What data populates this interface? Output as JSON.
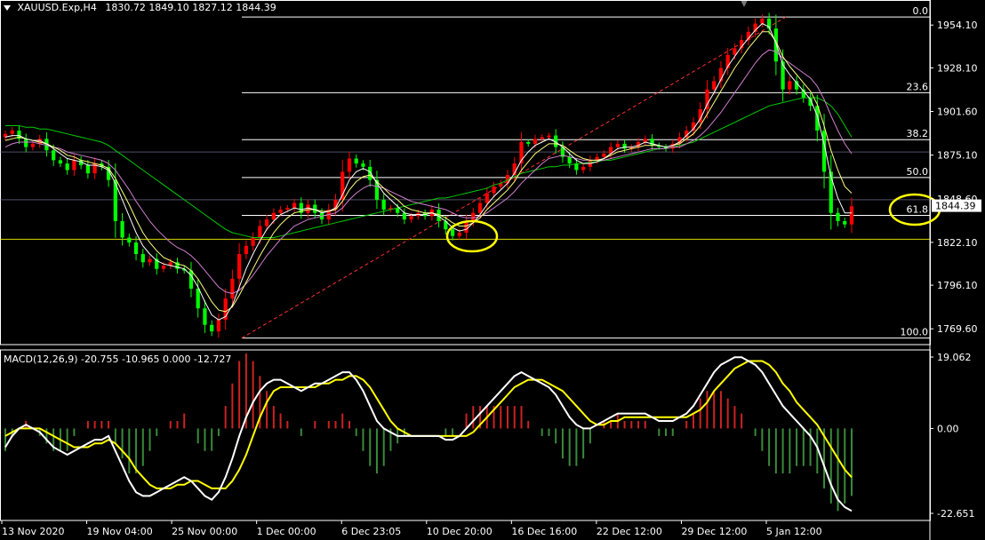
{
  "header": {
    "symbol": "XAUUSD.Exp,H4",
    "ohlc": "1830.72 1849.10 1827.12 1844.39"
  },
  "current_price_label": "1844.39",
  "macd": {
    "title": "MACD(12,26,9) -20.755 -10.965 0.000 -12.727",
    "scale_labels": [
      "19.062",
      "0.00",
      "-22.651"
    ]
  },
  "colors": {
    "background": "#000000",
    "bull": "#ff0000",
    "bear": "#00ff00",
    "ma_fast": "#ffffff",
    "ma_mid": "#ffff80",
    "ma_slow": "#d080d0",
    "ma_long": "#00cc00",
    "fib": "#ffffff",
    "trend": "#ff3030",
    "highlight": "#ffff00",
    "macd_main": "#ffffff",
    "macd_signal": "#ffff00",
    "hist_pos": "#cc2222",
    "hist_neg": "#3a8a3a"
  },
  "chart_data": [
    {
      "type": "candlestick",
      "title": "XAUUSD.Exp,H4",
      "price_axis_labels": [
        "1954.10",
        "1928.10",
        "1901.60",
        "1875.10",
        "1848.60",
        "1822.10",
        "1796.10",
        "1769.60"
      ],
      "ylim": [
        1760,
        1965
      ],
      "time_axis_labels": [
        "13 Nov 2020",
        "19 Nov 04:00",
        "25 Nov 00:00",
        "1 Dec 00:00",
        "6 Dec 23:05",
        "10 Dec 20:00",
        "16 Dec 16:00",
        "22 Dec 12:00",
        "29 Dec 12:00",
        "5 Jan 12:00"
      ],
      "last_price": 1844.39,
      "fibonacci": {
        "high": 1959,
        "low": 1764,
        "levels": [
          {
            "label": "0.0",
            "ratio": 0.0
          },
          {
            "label": "23.6",
            "ratio": 0.236
          },
          {
            "label": "38.2",
            "ratio": 0.382
          },
          {
            "label": "50.0",
            "ratio": 0.5
          },
          {
            "label": "61.8",
            "ratio": 0.618
          },
          {
            "label": "100.0",
            "ratio": 1.0
          }
        ]
      },
      "horizontal_lines": [
        1824,
        1848,
        1877
      ],
      "price_path": [
        1888,
        1890,
        1885,
        1880,
        1882,
        1885,
        1878,
        1872,
        1870,
        1866,
        1872,
        1869,
        1864,
        1870,
        1868,
        1860,
        1835,
        1825,
        1822,
        1815,
        1810,
        1812,
        1806,
        1808,
        1810,
        1806,
        1805,
        1794,
        1782,
        1772,
        1768,
        1775,
        1788,
        1800,
        1815,
        1820,
        1825,
        1832,
        1836,
        1840,
        1842,
        1843,
        1846,
        1840,
        1845,
        1840,
        1836,
        1842,
        1848,
        1865,
        1873,
        1870,
        1868,
        1860,
        1848,
        1842,
        1843,
        1840,
        1836,
        1838,
        1840,
        1838,
        1842,
        1835,
        1830,
        1826,
        1828,
        1835,
        1840,
        1846,
        1852,
        1856,
        1858,
        1863,
        1870,
        1883,
        1882,
        1885,
        1886,
        1887,
        1880,
        1874,
        1870,
        1866,
        1868,
        1872,
        1874,
        1876,
        1880,
        1882,
        1879,
        1880,
        1883,
        1885,
        1881,
        1880,
        1879,
        1882,
        1886,
        1890,
        1895,
        1903,
        1915,
        1920,
        1928,
        1936,
        1940,
        1945,
        1950,
        1955,
        1958,
        1952,
        1932,
        1915,
        1920,
        1915,
        1910,
        1905,
        1890,
        1865,
        1840,
        1835,
        1833,
        1844
      ],
      "ma_fast": [
        1886,
        1887,
        1887,
        1885,
        1884,
        1884,
        1882,
        1879,
        1876,
        1873,
        1872,
        1871,
        1869,
        1869,
        1868,
        1866,
        1858,
        1848,
        1838,
        1828,
        1820,
        1815,
        1811,
        1809,
        1808,
        1807,
        1806,
        1802,
        1795,
        1786,
        1778,
        1775,
        1777,
        1784,
        1795,
        1806,
        1815,
        1823,
        1830,
        1835,
        1839,
        1841,
        1843,
        1842,
        1843,
        1842,
        1840,
        1841,
        1843,
        1851,
        1860,
        1865,
        1867,
        1865,
        1858,
        1852,
        1848,
        1844,
        1840,
        1839,
        1839,
        1839,
        1840,
        1838,
        1835,
        1831,
        1829,
        1830,
        1834,
        1839,
        1845,
        1850,
        1854,
        1858,
        1864,
        1872,
        1877,
        1881,
        1883,
        1885,
        1883,
        1880,
        1876,
        1872,
        1870,
        1870,
        1871,
        1873,
        1876,
        1879,
        1880,
        1880,
        1881,
        1883,
        1882,
        1881,
        1880,
        1881,
        1883,
        1887,
        1891,
        1897,
        1906,
        1913,
        1921,
        1929,
        1935,
        1941,
        1946,
        1951,
        1955,
        1953,
        1943,
        1930,
        1924,
        1919,
        1914,
        1909,
        1899,
        1882,
        1862,
        1849,
        1840,
        1840
      ],
      "ma_mid": [
        1884,
        1885,
        1886,
        1885,
        1884,
        1883,
        1882,
        1880,
        1878,
        1875,
        1874,
        1872,
        1871,
        1870,
        1869,
        1867,
        1861,
        1853,
        1845,
        1836,
        1828,
        1822,
        1817,
        1813,
        1811,
        1809,
        1808,
        1805,
        1800,
        1793,
        1786,
        1781,
        1780,
        1783,
        1790,
        1798,
        1806,
        1814,
        1821,
        1828,
        1833,
        1837,
        1840,
        1841,
        1842,
        1842,
        1841,
        1841,
        1842,
        1847,
        1854,
        1859,
        1862,
        1863,
        1859,
        1855,
        1851,
        1848,
        1844,
        1842,
        1841,
        1840,
        1840,
        1839,
        1837,
        1834,
        1832,
        1832,
        1834,
        1837,
        1842,
        1846,
        1850,
        1854,
        1859,
        1866,
        1871,
        1876,
        1879,
        1882,
        1882,
        1881,
        1878,
        1875,
        1873,
        1872,
        1872,
        1873,
        1875,
        1877,
        1878,
        1879,
        1880,
        1881,
        1881,
        1881,
        1880,
        1881,
        1882,
        1885,
        1888,
        1893,
        1900,
        1907,
        1914,
        1921,
        1928,
        1934,
        1940,
        1945,
        1950,
        1950,
        1944,
        1935,
        1929,
        1924,
        1919,
        1914,
        1906,
        1893,
        1878,
        1866,
        1856,
        1852
      ],
      "ma_slow": [
        1880,
        1882,
        1883,
        1883,
        1883,
        1882,
        1881,
        1880,
        1879,
        1877,
        1876,
        1875,
        1874,
        1873,
        1872,
        1870,
        1866,
        1860,
        1854,
        1847,
        1841,
        1835,
        1830,
        1826,
        1822,
        1819,
        1817,
        1814,
        1810,
        1805,
        1800,
        1795,
        1792,
        1791,
        1793,
        1797,
        1802,
        1808,
        1814,
        1819,
        1824,
        1828,
        1832,
        1834,
        1836,
        1837,
        1838,
        1839,
        1840,
        1843,
        1848,
        1852,
        1855,
        1857,
        1856,
        1855,
        1853,
        1851,
        1849,
        1847,
        1846,
        1845,
        1844,
        1843,
        1842,
        1840,
        1838,
        1837,
        1837,
        1838,
        1840,
        1843,
        1846,
        1849,
        1853,
        1858,
        1862,
        1866,
        1870,
        1873,
        1874,
        1875,
        1874,
        1873,
        1872,
        1872,
        1872,
        1872,
        1873,
        1874,
        1875,
        1876,
        1877,
        1878,
        1879,
        1879,
        1879,
        1880,
        1880,
        1882,
        1884,
        1887,
        1891,
        1896,
        1901,
        1907,
        1913,
        1919,
        1925,
        1931,
        1936,
        1939,
        1938,
        1934,
        1931,
        1928,
        1925,
        1922,
        1917,
        1909,
        1899,
        1890,
        1882,
        1876
      ],
      "ma_long": [
        1893,
        1893,
        1893,
        1892,
        1892,
        1891,
        1891,
        1890,
        1889,
        1888,
        1887,
        1886,
        1885,
        1884,
        1883,
        1881,
        1878,
        1875,
        1872,
        1869,
        1866,
        1863,
        1860,
        1857,
        1854,
        1851,
        1848,
        1845,
        1842,
        1839,
        1836,
        1833,
        1830,
        1828,
        1827,
        1826,
        1825,
        1825,
        1825,
        1825,
        1826,
        1827,
        1828,
        1829,
        1830,
        1831,
        1832,
        1833,
        1834,
        1835,
        1836,
        1837,
        1838,
        1839,
        1840,
        1841,
        1842,
        1843,
        1844,
        1845,
        1846,
        1847,
        1848,
        1849,
        1849,
        1850,
        1851,
        1852,
        1853,
        1854,
        1855,
        1857,
        1858,
        1860,
        1862,
        1864,
        1865,
        1866,
        1867,
        1868,
        1868,
        1869,
        1869,
        1870,
        1870,
        1871,
        1871,
        1872,
        1872,
        1873,
        1874,
        1875,
        1876,
        1877,
        1878,
        1879,
        1879,
        1880,
        1881,
        1882,
        1883,
        1885,
        1887,
        1889,
        1891,
        1893,
        1895,
        1897,
        1899,
        1901,
        1903,
        1905,
        1906,
        1907,
        1908,
        1909,
        1910,
        1910,
        1910,
        1908,
        1905,
        1900,
        1893,
        1886
      ]
    },
    {
      "type": "macd",
      "title": "MACD(12,26,9) -20.755 -10.965 0.000 -12.727",
      "ylim": [
        -22.651,
        19.062
      ],
      "main": [
        -5,
        -2,
        0,
        1,
        0,
        -1,
        -3,
        -5,
        -6,
        -7,
        -6,
        -5,
        -4,
        -3,
        -3,
        -2,
        -6,
        -10,
        -14,
        -17,
        -18,
        -18,
        -17,
        -16,
        -15,
        -14,
        -13,
        -14,
        -16,
        -18,
        -19,
        -17,
        -13,
        -8,
        -2,
        3,
        7,
        10,
        12,
        13,
        13,
        12,
        11,
        10,
        11,
        12,
        12,
        13,
        14,
        15,
        15,
        13,
        10,
        6,
        2,
        0,
        -1,
        -2,
        -2,
        -2,
        -2,
        -2,
        -2,
        -2,
        -3,
        -3,
        -2,
        0,
        2,
        4,
        6,
        8,
        10,
        12,
        14,
        15,
        14,
        13,
        12,
        11,
        9,
        6,
        3,
        1,
        0,
        0,
        1,
        2,
        3,
        4,
        4,
        4,
        4,
        4,
        3,
        2,
        2,
        2,
        3,
        4,
        6,
        9,
        12,
        15,
        17,
        18,
        19,
        19,
        18,
        17,
        15,
        12,
        9,
        6,
        4,
        2,
        0,
        -2,
        -5,
        -10,
        -15,
        -19,
        -21,
        -22
      ],
      "signal": [
        -2,
        -1,
        0,
        0,
        0,
        0,
        -1,
        -2,
        -3,
        -4,
        -5,
        -5,
        -5,
        -4,
        -4,
        -3,
        -4,
        -6,
        -8,
        -11,
        -13,
        -15,
        -16,
        -16,
        -16,
        -15,
        -15,
        -14,
        -14,
        -15,
        -16,
        -16,
        -16,
        -14,
        -11,
        -7,
        -2,
        3,
        7,
        10,
        11,
        11,
        11,
        11,
        11,
        11,
        12,
        12,
        13,
        13,
        14,
        14,
        13,
        11,
        8,
        5,
        2,
        0,
        -1,
        -2,
        -2,
        -2,
        -2,
        -2,
        -2,
        -2,
        -2,
        -2,
        -1,
        1,
        3,
        5,
        7,
        9,
        11,
        12,
        13,
        13,
        13,
        12,
        11,
        10,
        8,
        6,
        4,
        2,
        1,
        1,
        2,
        2,
        3,
        3,
        3,
        3,
        3,
        3,
        3,
        3,
        3,
        3,
        4,
        5,
        7,
        10,
        12,
        14,
        16,
        17,
        18,
        18,
        18,
        17,
        15,
        12,
        10,
        7,
        5,
        3,
        1,
        -2,
        -5,
        -8,
        -11,
        -13
      ]
    }
  ]
}
